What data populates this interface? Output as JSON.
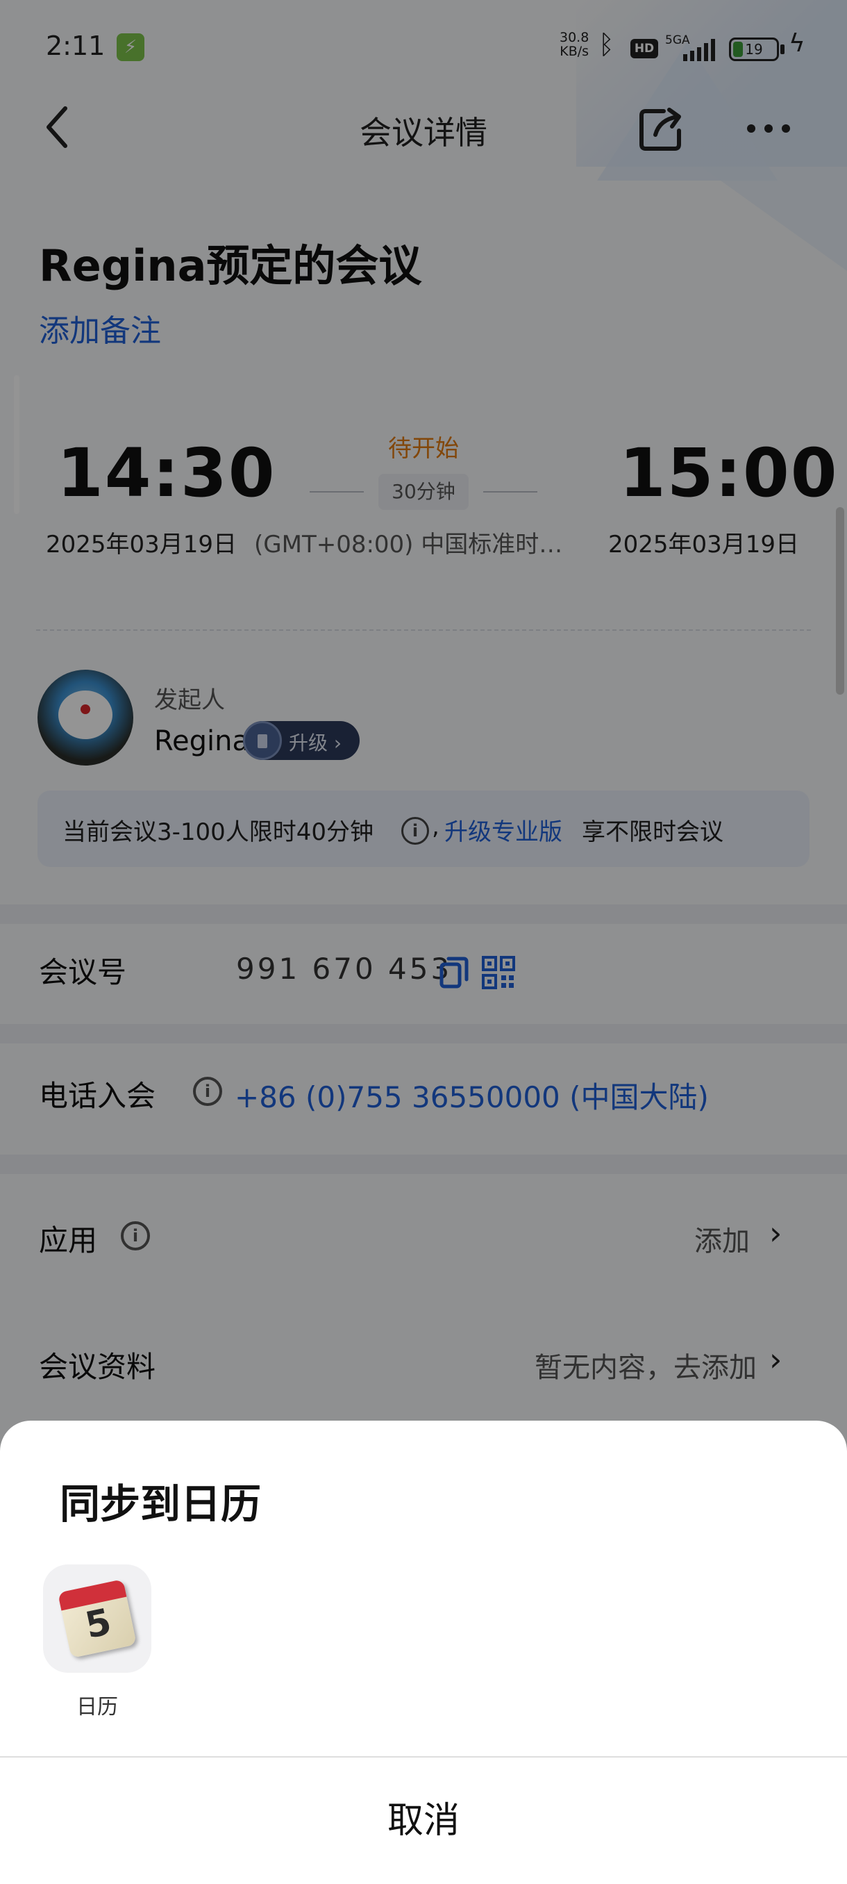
{
  "status_bar": {
    "time": "2:11",
    "net_speed": "30.8",
    "net_speed_unit": "KB/s",
    "hd_badge": "HD",
    "network": "5GA",
    "battery": "19"
  },
  "nav": {
    "title": "会议详情"
  },
  "meeting": {
    "title": "Regina预定的会议",
    "add_note": "添加备注",
    "status": "待开始",
    "start_time": "14:30",
    "end_time": "15:00",
    "duration": "30分钟",
    "start_date": "2025年03月19日",
    "timezone": "(GMT+08:00) 中国标准时…",
    "end_date": "2025年03月19日"
  },
  "host": {
    "label": "发起人",
    "name": "Regina",
    "upgrade_label": "升级 ›"
  },
  "limit_notice": {
    "text_before": "当前会议3-100人限时40分钟",
    "info_glyph": "i",
    "comma": ",",
    "link": "升级专业版",
    "text_after": "享不限时会议"
  },
  "rows": {
    "meeting_id_label": "会议号",
    "meeting_id_value": "991 670 453",
    "phone_label": "电话入会",
    "phone_value": "+86 (0)755 36550000 (中国大陆)",
    "apps_label": "应用",
    "apps_action": "添加",
    "docs_label": "会议资料",
    "docs_action": "暂无内容，去添加"
  },
  "sheet": {
    "title": "同步到日历",
    "app_label": "日历",
    "app_icon_number": "5",
    "cancel": "取消"
  }
}
